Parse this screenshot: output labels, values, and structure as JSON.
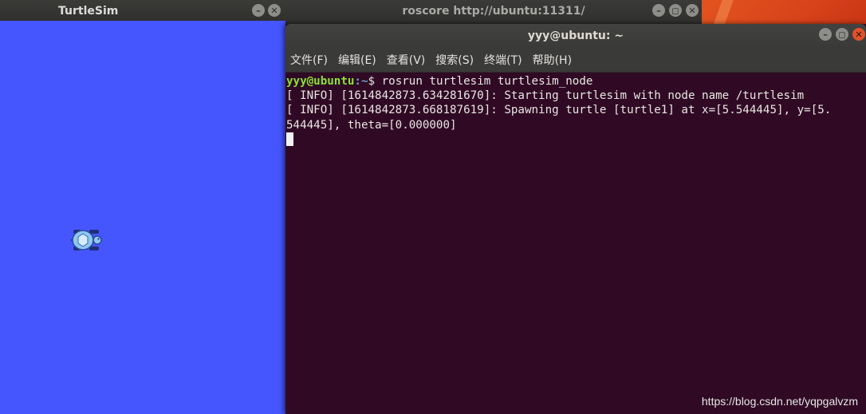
{
  "colors": {
    "turtlesim_bg": "#4556ff",
    "terminal_bg": "#300a24",
    "prompt_user": "#8ae234",
    "prompt_path": "#729fcf",
    "wallpaper": "#e2541f"
  },
  "turtlesim": {
    "title": "TurtleSim",
    "buttons": {
      "minimize": "–",
      "close": "✕"
    }
  },
  "roscore": {
    "title": "roscore http://ubuntu:11311/",
    "buttons": {
      "minimize": "–",
      "maximize": "◻",
      "close": "✕"
    }
  },
  "terminal": {
    "title": "yyy@ubuntu: ~",
    "buttons": {
      "minimize": "–",
      "maximize": "◻",
      "close": "✕"
    },
    "menu": [
      {
        "label": "文件(F)"
      },
      {
        "label": "编辑(E)"
      },
      {
        "label": "查看(V)"
      },
      {
        "label": "搜索(S)"
      },
      {
        "label": "终端(T)"
      },
      {
        "label": "帮助(H)"
      }
    ],
    "prompt_user": "yyy@ubuntu",
    "prompt_path": ":~",
    "prompt_symbol": "$ ",
    "command": "rosrun turtlesim turtlesim_node",
    "output": [
      "[ INFO] [1614842873.634281670]: Starting turtlesim with node name /turtlesim",
      "[ INFO] [1614842873.668187619]: Spawning turtle [turtle1] at x=[5.544445], y=[5.",
      "544445], theta=[0.000000]"
    ]
  },
  "watermark": "https://blog.csdn.net/yqpgalvzm"
}
